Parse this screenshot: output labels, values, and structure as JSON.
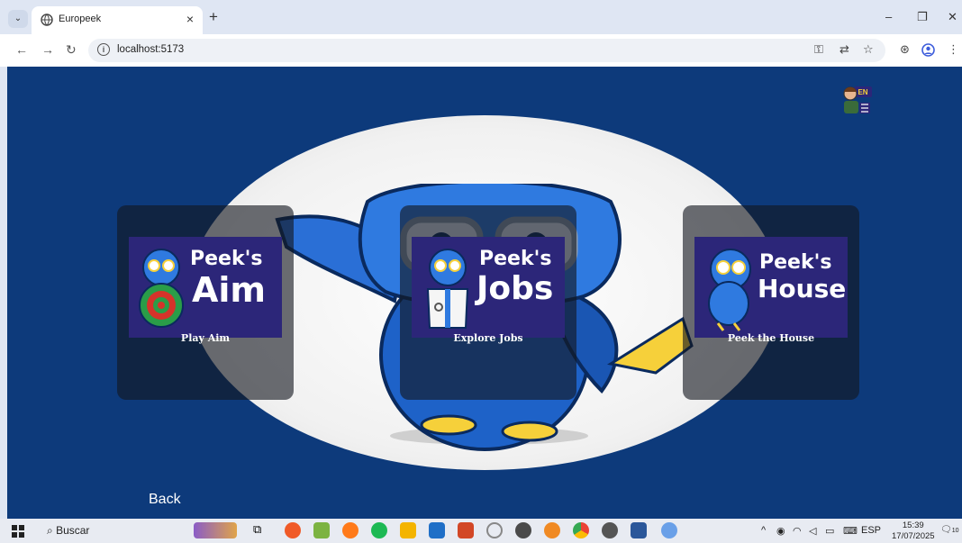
{
  "browser": {
    "tab_title": "Europeek",
    "url": "localhost:5173"
  },
  "games": [
    {
      "logo_line1": "Peek's",
      "logo_line2": "Aim",
      "label": "Play Aim"
    },
    {
      "logo_line1": "Peek's",
      "logo_line2": "Jobs",
      "label": "Explore Jobs"
    },
    {
      "logo_line1": "Peek's",
      "logo_line2": "House",
      "label": "Peek the House"
    }
  ],
  "back_label": "Back",
  "language_badge": "EN",
  "taskbar": {
    "search_label": "Buscar",
    "language": "ESP",
    "time": "15:39",
    "date": "17/07/2025",
    "notification_count": "10"
  },
  "colors": {
    "page_background": "#0d3a7b",
    "card_background": "#2c2679",
    "mascot_blue": "#1e62c8"
  }
}
